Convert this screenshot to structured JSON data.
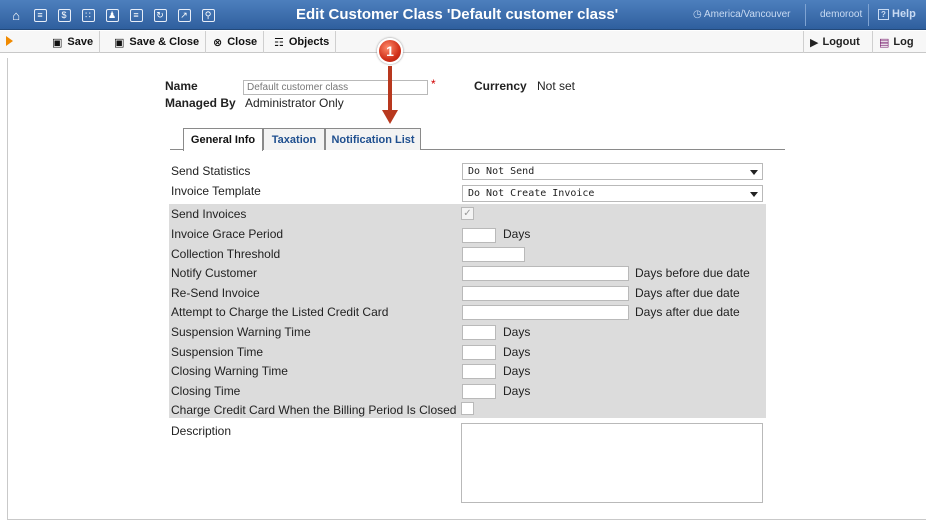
{
  "header": {
    "title": "Edit Customer Class 'Default customer class'",
    "timezone": "America/Vancouver",
    "user": "demoroot",
    "help": "Help",
    "nav_icons": [
      "home-icon",
      "list-icon",
      "dollar-icon",
      "grid-icon",
      "person-icon",
      "tree-icon",
      "transfer-icon",
      "chart-icon",
      "search-icon"
    ]
  },
  "toolbar": {
    "save": "Save",
    "save_close": "Save & Close",
    "close": "Close",
    "objects": "Objects",
    "logout": "Logout",
    "log": "Log"
  },
  "annotation": {
    "number": "1"
  },
  "form": {
    "name_label": "Name",
    "name_value": "Default customer class",
    "currency_label": "Currency",
    "currency_value": "Not set",
    "managed_by_label": "Managed By",
    "managed_by_value": "Administrator Only"
  },
  "tabs": [
    {
      "label": "General Info",
      "active": true
    },
    {
      "label": "Taxation",
      "active": false
    },
    {
      "label": "Notification List",
      "active": false
    }
  ],
  "fields": {
    "send_statistics": {
      "label": "Send Statistics",
      "value": "Do Not Send"
    },
    "invoice_template": {
      "label": "Invoice Template",
      "value": "Do Not Create Invoice"
    },
    "send_invoices": {
      "label": "Send Invoices",
      "checked": true
    },
    "invoice_grace_period": {
      "label": "Invoice Grace Period",
      "suffix": "Days"
    },
    "collection_threshold": {
      "label": "Collection Threshold"
    },
    "notify_customer": {
      "label": "Notify Customer",
      "suffix": "Days before due date"
    },
    "resend_invoice": {
      "label": "Re-Send Invoice",
      "suffix": "Days after due date"
    },
    "attempt_charge": {
      "label": "Attempt to Charge the Listed Credit Card",
      "suffix": "Days after due date"
    },
    "suspension_warning": {
      "label": "Suspension Warning Time",
      "suffix": "Days"
    },
    "suspension_time": {
      "label": "Suspension Time",
      "suffix": "Days"
    },
    "closing_warning": {
      "label": "Closing Warning Time",
      "suffix": "Days"
    },
    "closing_time": {
      "label": "Closing Time",
      "suffix": "Days"
    },
    "charge_cc_closed": {
      "label": "Charge Credit Card When the Billing Period Is Closed",
      "checked": false
    },
    "description": {
      "label": "Description",
      "value": ""
    }
  },
  "colors": {
    "header_bg": "#3a6aab",
    "tab_link": "#1f4f8f",
    "shaded_rows": "#dcdcdc",
    "annotation": "#d0301a"
  }
}
